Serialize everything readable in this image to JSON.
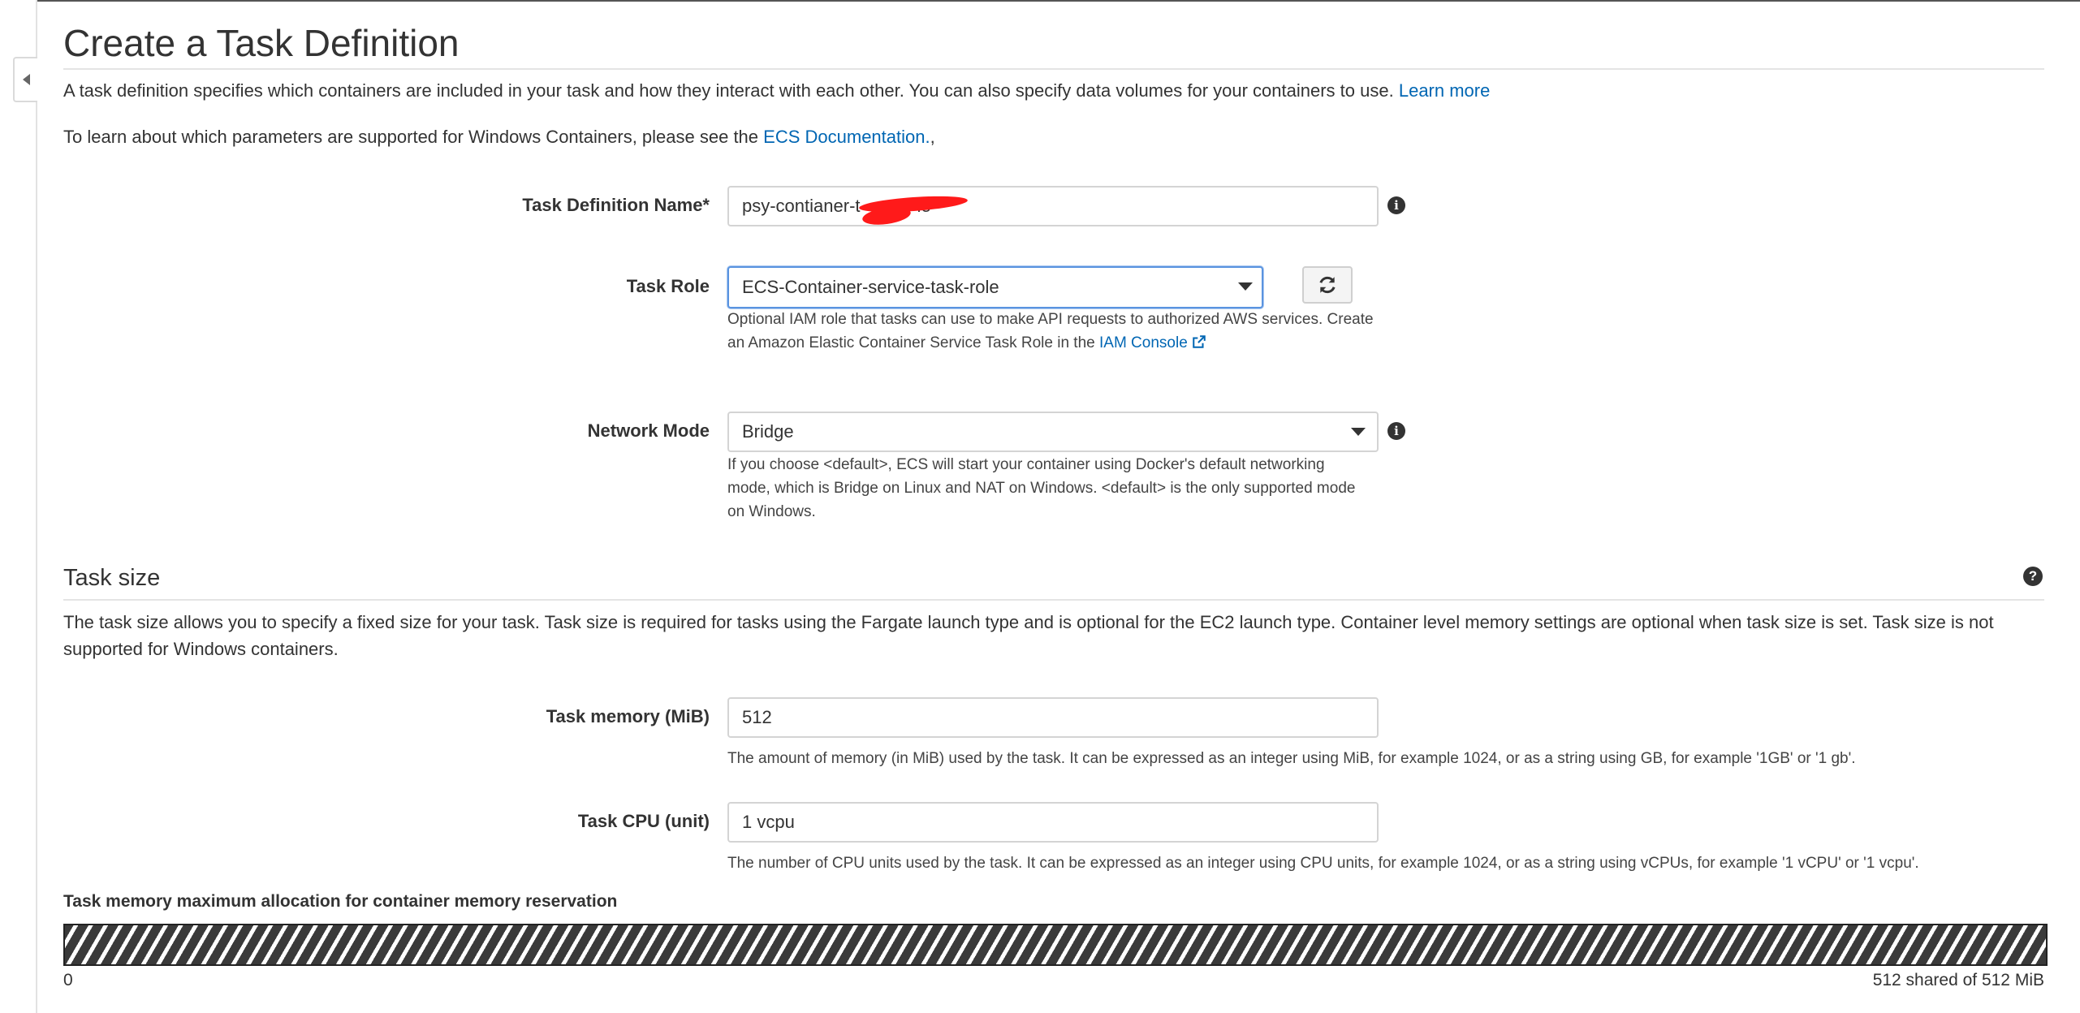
{
  "page": {
    "title": "Create a Task Definition",
    "intro_text": "A task definition specifies which containers are included in your task and how they interact with each other. You can also specify data volumes for your containers to use.",
    "intro_link": "Learn more",
    "windows_text": "To learn about which parameters are supported for Windows Containers, please see the",
    "windows_link": "ECS Documentation.",
    "windows_suffix": ","
  },
  "form": {
    "task_definition_name": {
      "label": "Task Definition Name*",
      "value": "psy-contianer-t",
      "value_tail": "le"
    },
    "task_role": {
      "label": "Task Role",
      "value": "ECS-Container-service-task-role",
      "help_line1": "Optional IAM role that tasks can use to make API requests to authorized AWS services. Create",
      "help_line2": "an Amazon Elastic Container Service Task Role in the",
      "help_link": "IAM Console"
    },
    "network_mode": {
      "label": "Network Mode",
      "value": "Bridge",
      "help_line1": "If you choose <default>, ECS will start your container using Docker's default networking",
      "help_line2": "mode, which is Bridge on Linux and NAT on Windows. <default> is the only supported mode",
      "help_line3": "on Windows."
    }
  },
  "task_size": {
    "title": "Task size",
    "desc_line1": "The task size allows you to specify a fixed size for your task. Task size is required for tasks using the Fargate launch type and is optional for the EC2 launch type. Container level memory settings are optional when task size is set. Task size is not",
    "desc_line2": "supported for Windows containers.",
    "memory": {
      "label": "Task memory (MiB)",
      "value": "512",
      "help": "The amount of memory (in MiB) used by the task. It can be expressed as an integer using MiB, for example 1024, or as a string using GB, for example '1GB' or '1 gb'."
    },
    "cpu": {
      "label": "Task CPU (unit)",
      "value": "1 vcpu",
      "help": "The number of CPU units used by the task. It can be expressed as an integer using CPU units, for example 1024, or as a string using vCPUs, for example '1 vCPU' or '1 vcpu'."
    },
    "allocation": {
      "title": "Task memory maximum allocation for container memory reservation",
      "min_label": "0",
      "max_label": "512 shared of 512 MiB",
      "fill_fraction": 1.0
    }
  },
  "icons": {
    "info": "info-icon",
    "help": "question-icon",
    "refresh": "refresh-icon",
    "external": "external-link-icon",
    "collapse": "collapse-left-icon"
  },
  "colors": {
    "link": "#0066b3",
    "focus_border": "#5a94e0",
    "redaction": "#ff1a1a"
  }
}
